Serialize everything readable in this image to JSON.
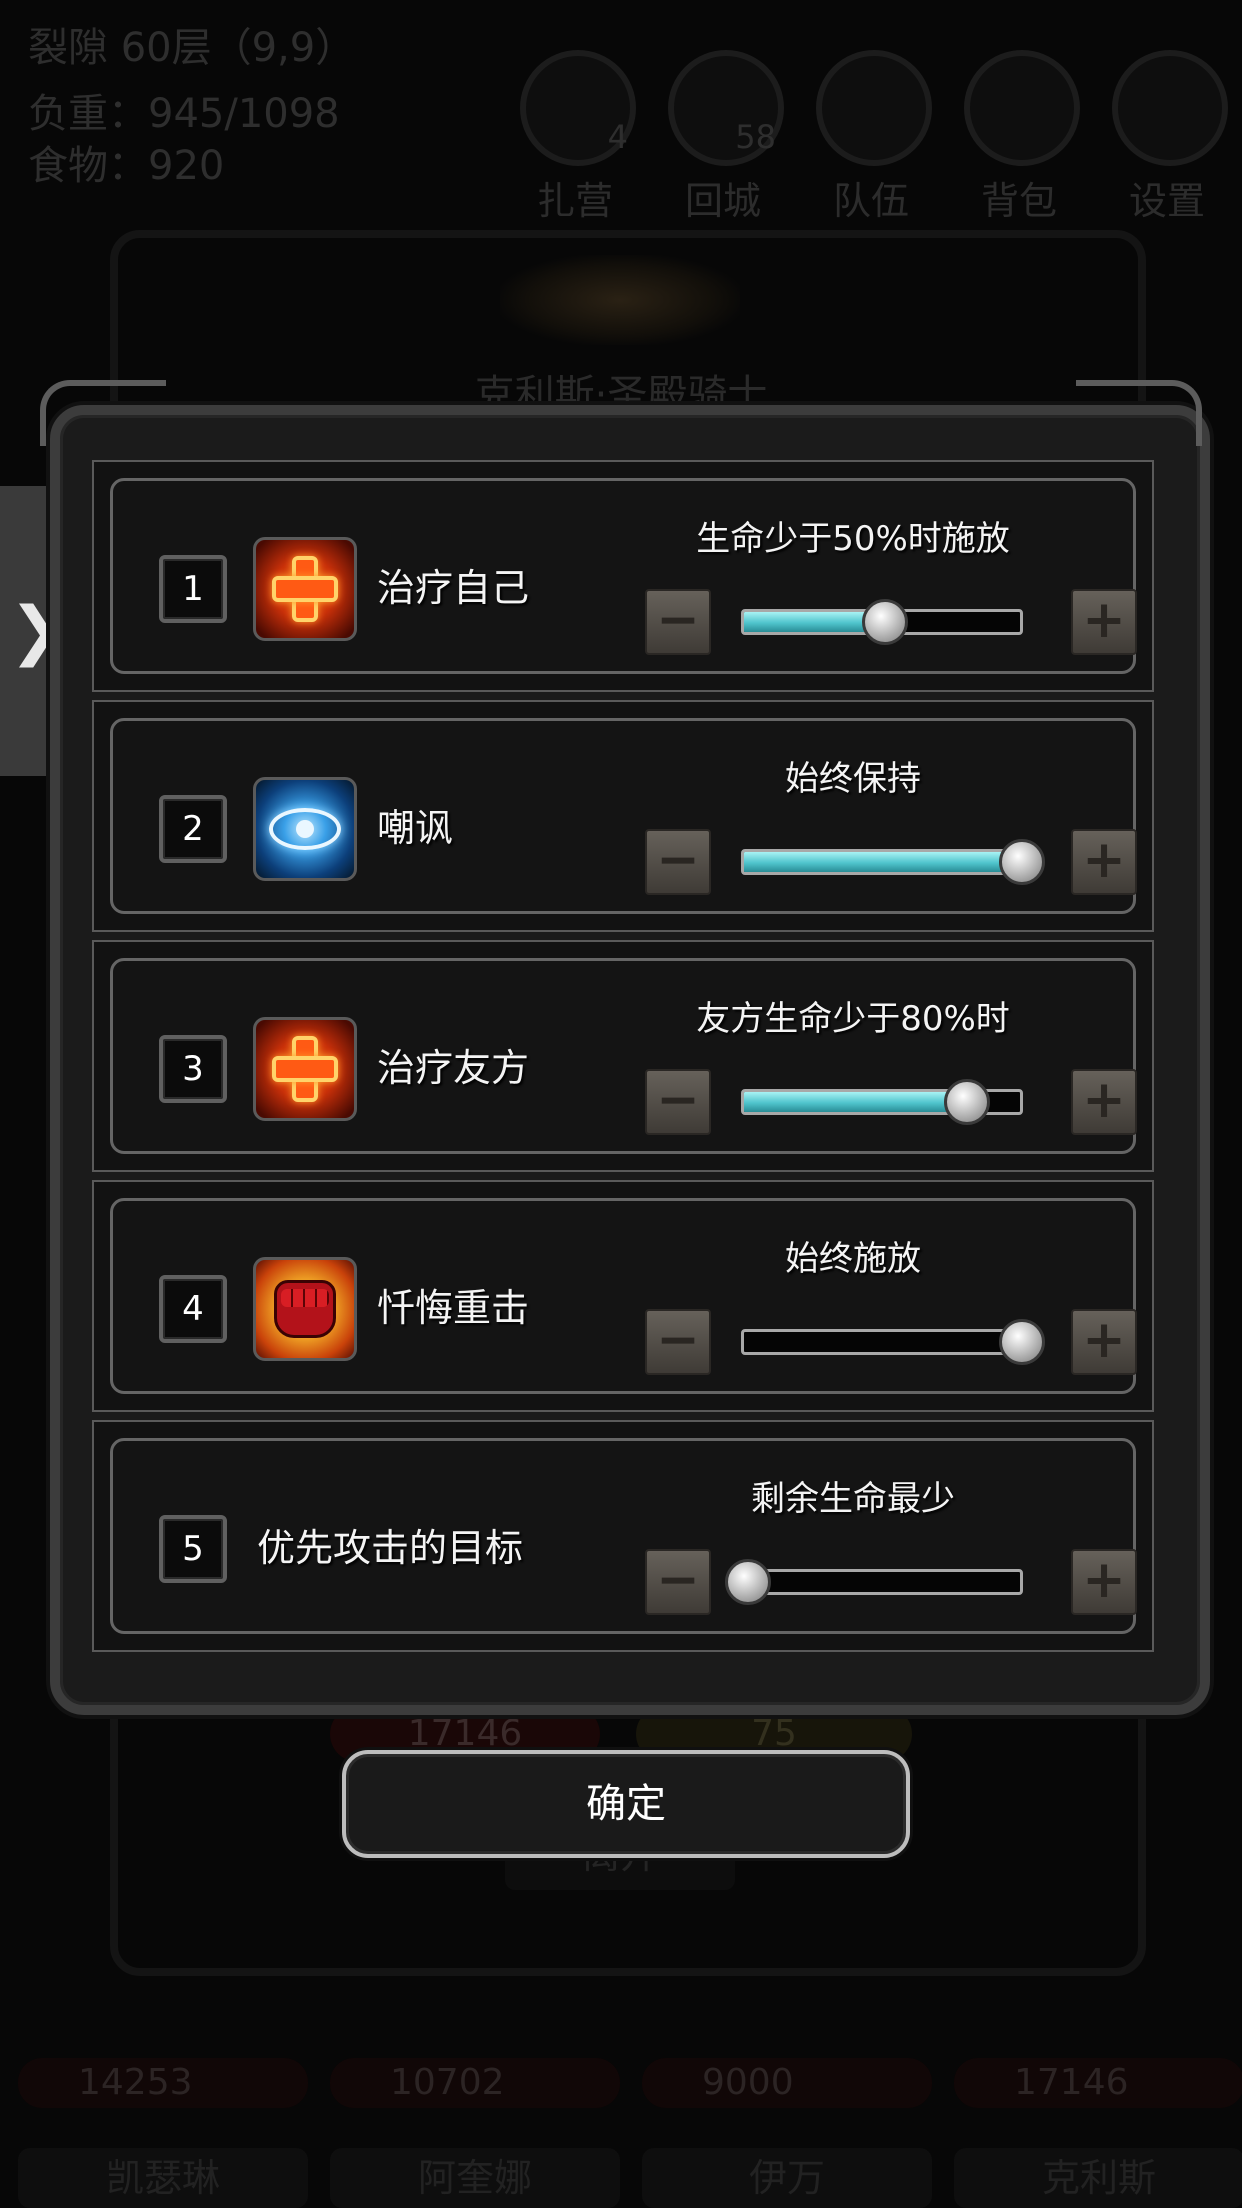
{
  "hud": {
    "location": "裂隙 60层（9,9）",
    "load": "负重：945/1098",
    "food": "食物：920"
  },
  "top_menu": [
    {
      "label": "扎营",
      "badge": "4",
      "icon": "camp-icon"
    },
    {
      "label": "回城",
      "badge": "58",
      "icon": "return-town-icon"
    },
    {
      "label": "队伍",
      "badge": "",
      "icon": "party-icon"
    },
    {
      "label": "背包",
      "badge": "",
      "icon": "backpack-icon"
    },
    {
      "label": "设置",
      "badge": "",
      "icon": "gear-icon"
    }
  ],
  "background": {
    "character_title": "克利斯·圣殿骑士",
    "hp": "17146",
    "energy": "75",
    "leave_label": "离开",
    "party": [
      {
        "hp": "14253",
        "name": "凯瑟琳"
      },
      {
        "hp": "10702",
        "name": "阿奎娜"
      },
      {
        "hp": "9000",
        "name": "伊万"
      },
      {
        "hp": "17146",
        "name": "克利斯"
      }
    ]
  },
  "side_tab": {
    "glyph": "❯",
    "icon": "chevron-right-icon"
  },
  "tactics": [
    {
      "index": "1",
      "name": "治疗自己",
      "icon": "heal-cross-icon",
      "condition": "生命少于50%时施放",
      "level": 0.5,
      "filled": true
    },
    {
      "index": "2",
      "name": "嘲讽",
      "icon": "taunt-eye-icon",
      "condition": "始终保持",
      "level": 1.0,
      "filled": true
    },
    {
      "index": "3",
      "name": "治疗友方",
      "icon": "heal-cross-icon",
      "condition": "友方生命少于80%时",
      "level": 0.8,
      "filled": true
    },
    {
      "index": "4",
      "name": "忏悔重击",
      "icon": "fist-strike-icon",
      "condition": "始终施放",
      "level": 1.0,
      "filled": false
    },
    {
      "index": "5",
      "name": "优先攻击的目标",
      "icon": "",
      "condition": "剩余生命最少",
      "level": 0.0,
      "filled": false
    }
  ],
  "controls": {
    "minus": "−",
    "plus": "+"
  },
  "confirm_label": "确定",
  "colors": {
    "slider_fill": "#4fc4cc",
    "heal_icon": "#e04010",
    "taunt_icon": "#3aa0e8",
    "fist_icon": "#b3121a"
  }
}
